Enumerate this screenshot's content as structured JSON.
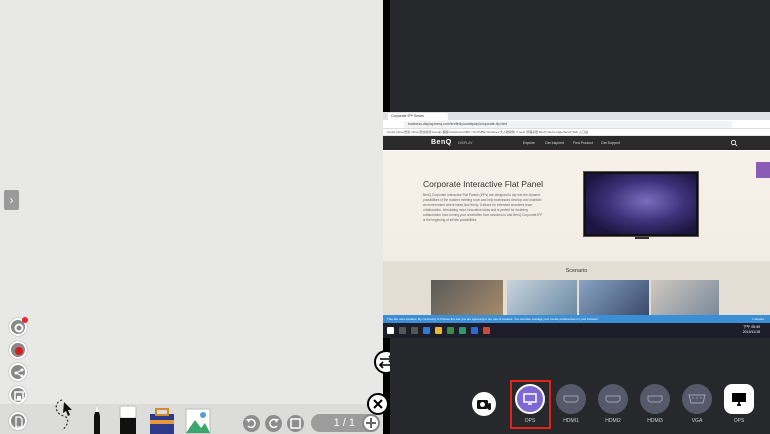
{
  "whiteboard": {
    "side_toggle_label": "›",
    "page_indicator": "1 / 1"
  },
  "browser": {
    "tab_title": "Corporate IFP Series",
    "url": "business.display.benq.com/en/findyourdisplay/corporate-ifp.html",
    "bookmarks": "Gmail  Yahoo奇摩  Yahoo奇摩新聞  Google 翻譯  Facebook  RMK  YOUTUBE  OneDrive  大人物報到  IT Help 管理系統  BenQ Web Image  BenQ Web 入口站",
    "brand": "BenQ",
    "brand_sub": "DISPLAY",
    "nav": [
      "Explore",
      "Get Inspired",
      "Find Product",
      "Get Support"
    ],
    "hero_title": "Corporate Interactive Flat Panel",
    "hero_body": "BenQ Corporate Interactive Flat Panels (IFPs) are designed to tap into the dynamic possibilities of the modern meeting room and help businesses develop and maintain an environment where ideas flow freely. It allows for extended seamless team collaboration, stimulating more innovative ideas and is perfect for fostering collaboration from turning your creativities from sessions to and BenQ Corporate IFP is the beginning of infinite possibilities.",
    "scenario_title": "Scenario",
    "cookie_text": "This site uses cookies. By continuing to browse the site you are agreeing to our use of cookies. You can also manage your cookie preferences on your browser.",
    "cookie_button": "I consent",
    "clock_time": "下午 05:49",
    "clock_date": "2019/11/18"
  },
  "sources": [
    {
      "label": "OPS"
    },
    {
      "label": "HDMI1"
    },
    {
      "label": "HDMI2"
    },
    {
      "label": "HDMI3"
    },
    {
      "label": "VGA"
    },
    {
      "label": "OPS"
    }
  ],
  "colors": {
    "dark_panel": "#26282c",
    "selected_source": "#7d68d4",
    "highlight": "#e0241b"
  }
}
